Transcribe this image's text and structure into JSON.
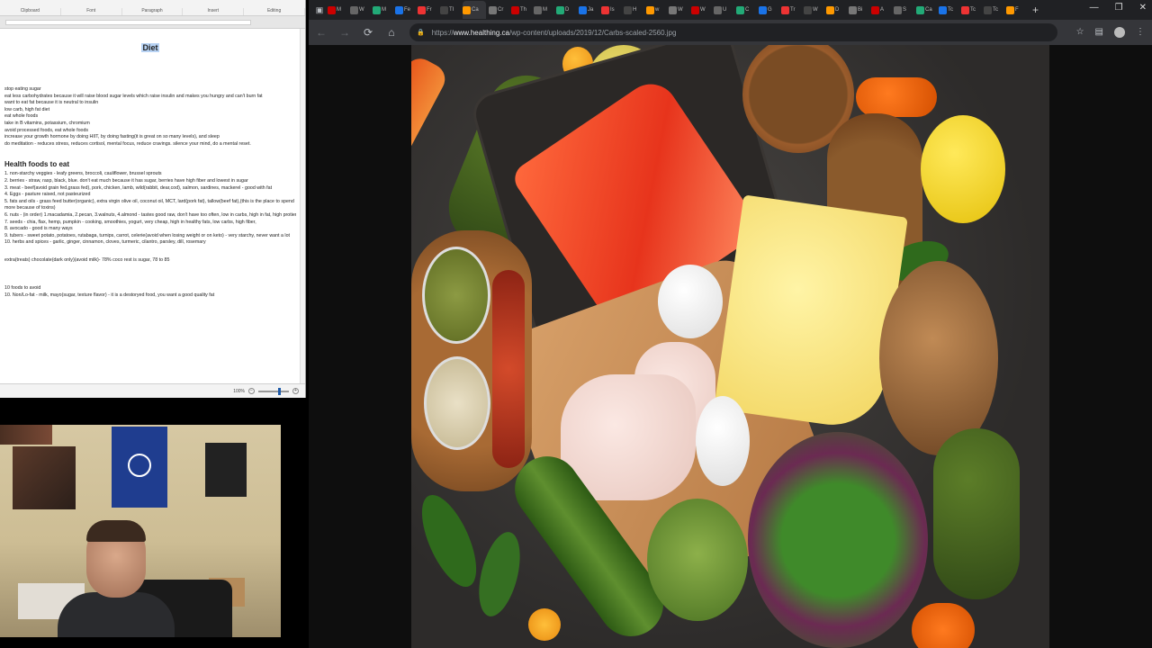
{
  "word": {
    "ribbon_groups": [
      "Clipboard",
      "Font",
      "Paragraph",
      "Insert",
      "Editing"
    ],
    "doc_title": "Diet",
    "intro_lines": [
      "stop eating sugar",
      "eat less carbohydrates because it will raise blood sugar levels which raise insulin and makes you hungry and can't burn fat",
      "want to eat fat because it is neutral to insulin",
      "low carb, high fat diet",
      "eat whole foods",
      "take in B vitamins, potassium, chromium",
      "avoid processed foods, eat whole foods",
      "increase your growth hormone by doing HIIT, by doing fasting(it is great on so many levels), and sleep",
      "do meditation - reduces stress, reduces cortisol, mental focus, reduce cravings.  silence your mind, do a mental reset."
    ],
    "section_heading": "Health foods to eat",
    "health_foods": [
      "1. non-starchy veggies - leafy greens, broccoli, cauliflower, brussel sprouts",
      "2. berries - straw, rasp, black, blue.  don't eat much because it has sugar, berries have high fiber and lowest in sugar",
      "3. meat - beef(avoid grain fed,grass fed), pork, chicken, lamb, wild(rabbit, dear,cod), salmon, sardines, mackerel - good with fat",
      "4. Eggs - pasture raised, not pasteurized",
      "5. fats and oils - grass feed butter(organic), extra virgin olive oil, coconut oil, MCT, lard(pork fat), tallow(beef fat),(this is the place to spend",
      "more because of toxins)",
      "6. nuts - (in order) 1.macadamia, 2.pecan, 3.walnuts, 4.almond - tastes good raw, don't have too often, low in carbs, high in fat, high protien",
      "7. seeds - chia, flax, hemp, pumpkin - cooking, smoothies, yogurt, very cheap, high in healthy fats, low carbs, high fiber,",
      "8. avocado - good is many ways",
      "9. tubers - sweet potato, potatoes, rutabaga, turnips, carrot, celerie(avoid when losing weight or on keto) - very starchy, never want a lot",
      "10. herbs and spices - garlic, ginger, cinnamon, cloves, turmeric, cilantro, parsley, dill, rosemary"
    ],
    "extra_line": "extra(treats) chocolate(dark only)(avoid milk)- 78% coco rest is sugar, 78 to 85",
    "avoid_heading": "10 foods to avoid",
    "avoid_line": "10. Non/Lo-fat - milk, mayo(sugar, texture flavor) - it is a destoryed food, you want a good quality fat",
    "zoom_label": "100%"
  },
  "browser": {
    "tab_letters": [
      "M",
      "W",
      "M",
      "Fe",
      "Fr",
      "TI",
      "Ca",
      "Cr",
      "Th",
      "M",
      "D",
      "Ja",
      "Is",
      "H",
      "w",
      "W",
      "W",
      "U",
      "C",
      "G",
      "Tr",
      "W",
      "D",
      "Bi",
      "A",
      "S",
      "Ca",
      "Tc",
      "Tc",
      "Tc",
      "F"
    ],
    "active_tab_letter": "Ca",
    "url_scheme": "https://",
    "url_host": "www.healthing.ca",
    "url_path": "/wp-content/uploads/2019/12/Carbs-scaled-2560.jpg",
    "new_tab_glyph": "+",
    "minimize_glyph": "—",
    "maximize_glyph": "❐",
    "close_glyph": "✕",
    "back_glyph": "←",
    "forward_glyph": "→",
    "reload_glyph": "⟳",
    "home_glyph": "⌂",
    "lock_glyph": "🔒",
    "extensions_glyph": "☆",
    "menu_glyph": "⋮"
  },
  "favicon_colors": [
    "#c00",
    "#666",
    "#2a7",
    "#1a73e8",
    "#e33",
    "#444",
    "#f90",
    "#777"
  ]
}
